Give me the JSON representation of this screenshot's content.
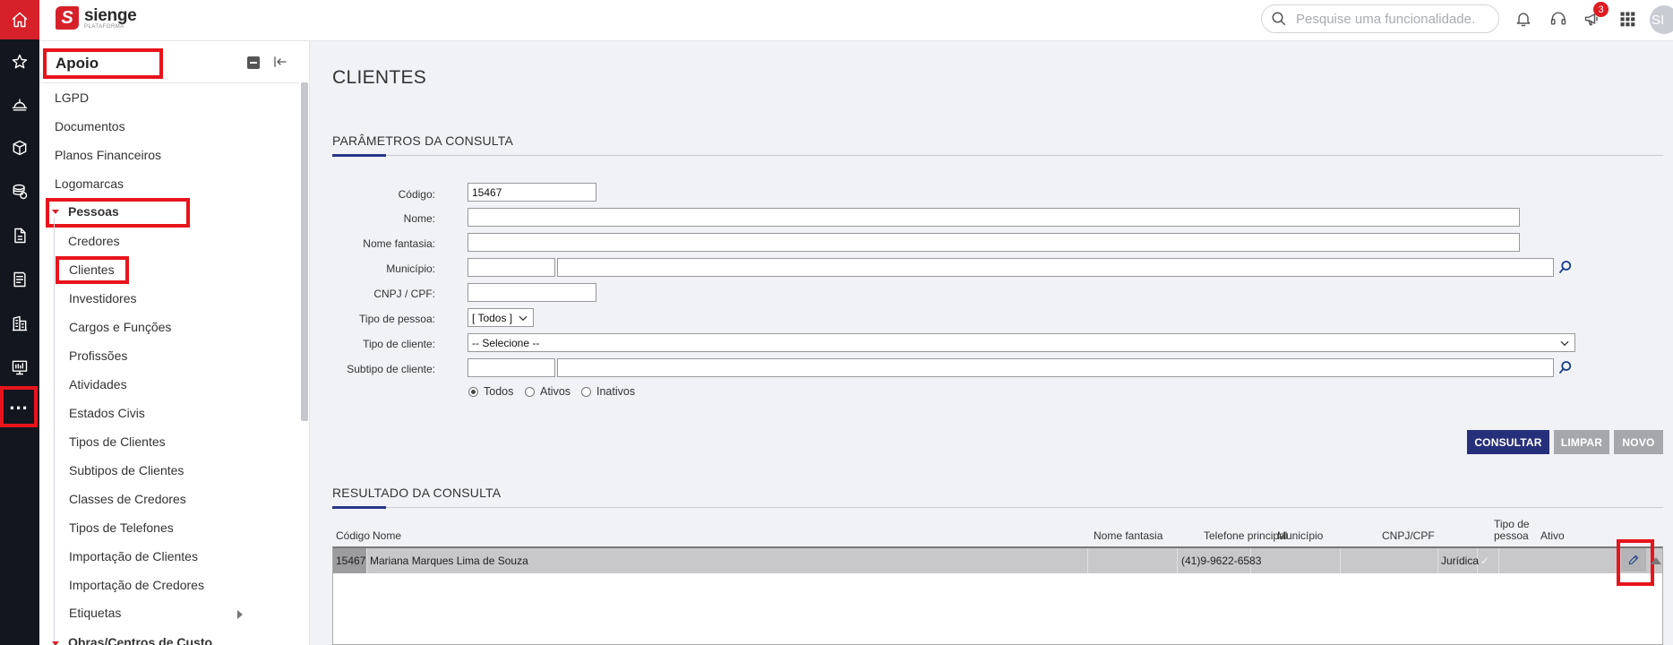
{
  "app": {
    "name": "sienge",
    "subname": "PLATAFORMA"
  },
  "search": {
    "placeholder": "Pesquise uma funcionalidade."
  },
  "notifications": {
    "badge": "3"
  },
  "user": {
    "initials": "SI"
  },
  "sidebar": {
    "title": "Apoio",
    "items": [
      {
        "label": "LGPD"
      },
      {
        "label": "Documentos"
      },
      {
        "label": "Planos Financeiros"
      },
      {
        "label": "Logomarcas"
      }
    ],
    "group": {
      "label": "Pessoas",
      "items": [
        {
          "label": "Credores"
        },
        {
          "label": "Clientes"
        },
        {
          "label": "Investidores"
        },
        {
          "label": "Cargos e Funções"
        },
        {
          "label": "Profissões"
        },
        {
          "label": "Atividades"
        },
        {
          "label": "Estados Civis"
        },
        {
          "label": "Tipos de Clientes"
        },
        {
          "label": "Subtipos de Clientes"
        },
        {
          "label": "Classes de Credores"
        },
        {
          "label": "Tipos de Telefones"
        },
        {
          "label": "Importação de Clientes"
        },
        {
          "label": "Importação de Credores"
        },
        {
          "label": "Etiquetas"
        }
      ]
    },
    "next_group": {
      "label": "Obras/Centros de Custo"
    }
  },
  "page": {
    "title": "CLIENTES"
  },
  "params": {
    "section_title": "PARÂMETROS DA CONSULTA",
    "codigo_label": "Código:",
    "codigo_value": "15467",
    "nome_label": "Nome:",
    "fantasia_label": "Nome fantasia:",
    "municipio_label": "Município:",
    "cnpj_label": "CNPJ / CPF:",
    "tipo_pessoa_label": "Tipo de pessoa:",
    "tipo_pessoa_value": "[ Todos ]",
    "tipo_cliente_label": "Tipo de cliente:",
    "tipo_cliente_value": "-- Selecione --",
    "subtipo_label": "Subtipo de cliente:",
    "status_options": [
      "Todos",
      "Ativos",
      "Inativos"
    ],
    "status_selected": "Todos"
  },
  "actions": {
    "consultar": "CONSULTAR",
    "limpar": "LIMPAR",
    "novo": "NOVO"
  },
  "colors": {
    "brand_red": "#d6212a",
    "primary_button": "#26307a",
    "disabled_button": "#a6a7ab",
    "highlight": "#e8141c"
  },
  "results": {
    "section_title": "RESULTADO DA CONSULTA",
    "columns": [
      "Código",
      "Nome",
      "Nome fantasia",
      "Telefone principal",
      "Município",
      "CNPJ/CPF",
      "Tipo de pessoa",
      "Ativo"
    ],
    "rows": [
      {
        "codigo": "15467",
        "nome": "Mariana Marques Lima de Souza",
        "fantasia": "",
        "telefone": "(41)9-9622-6583",
        "municipio": "",
        "cnpj": "",
        "tipo": "Jurídica",
        "ativo": "✓"
      }
    ]
  }
}
